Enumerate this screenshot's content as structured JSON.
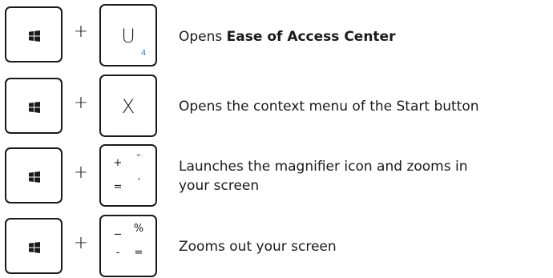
{
  "rows": [
    {
      "key_main": "U",
      "key_sub": "4",
      "desc_prefix": "Opens ",
      "desc_bold": "Ease of Access Center"
    },
    {
      "key_main": "X",
      "desc_line1": "Opens the context menu of the Start button"
    },
    {
      "key_top_left": "+",
      "key_top_right": "˘",
      "key_bottom_left": "=",
      "key_bottom_right": "´",
      "desc_line1": "Launches the magnifier icon and zooms in",
      "desc_line2": "your screen"
    },
    {
      "key_top_left": "_",
      "key_top_right": "%",
      "key_bottom_left": "-",
      "key_bottom_right": "=",
      "desc_line1": "Zooms out your screen"
    }
  ],
  "plus_sign": "+",
  "colors": {
    "text": "#1a1a1a",
    "accent_sub": "#3d7fc7"
  },
  "icons": {
    "windows_key": "windows-logo-icon"
  }
}
